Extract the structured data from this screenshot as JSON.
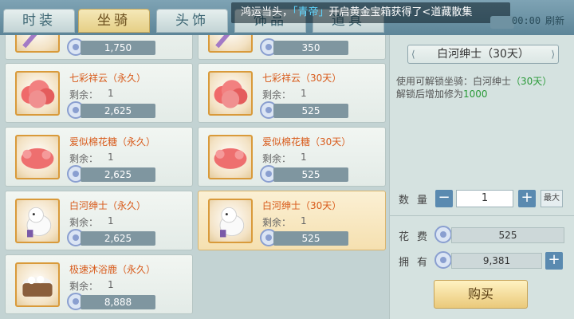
{
  "tabs": [
    "时装",
    "坐骑",
    "头饰",
    "饰品",
    "道具"
  ],
  "active_tab": 1,
  "marquee": {
    "prefix": "鸿运当头，",
    "player": "「青帝」",
    "suffix": "开启黄金宝箱获得了<道藏散集"
  },
  "timer": "00:00",
  "refresh_label": "刷新",
  "remain_label": "剩余：",
  "items": [
    {
      "name": "",
      "remain": "",
      "price": "1,750"
    },
    {
      "name": "",
      "remain": "",
      "price": "350"
    },
    {
      "name": "七彩祥云（永久）",
      "remain": "1",
      "price": "2,625",
      "icon": "cloud-icon"
    },
    {
      "name": "七彩祥云（30天）",
      "remain": "1",
      "price": "525",
      "icon": "cloud-icon"
    },
    {
      "name": "爱似棉花糖（永久）",
      "remain": "1",
      "price": "2,625",
      "icon": "cotton-candy-icon"
    },
    {
      "name": "爱似棉花糖（30天）",
      "remain": "1",
      "price": "525",
      "icon": "cotton-candy-icon"
    },
    {
      "name": "白河绅士（永久）",
      "remain": "1",
      "price": "2,625",
      "icon": "white-horse-icon"
    },
    {
      "name": "白河绅士（30天）",
      "remain": "1",
      "price": "525",
      "icon": "white-horse-icon",
      "selected": true
    },
    {
      "name": "极速沐浴鹿（永久）",
      "remain": "1",
      "price": "8,888",
      "icon": "bath-tub-icon"
    }
  ],
  "detail": {
    "title": "白河绅士（30天）",
    "desc_prefix": "使用可解锁坐骑：白河绅士",
    "desc_green": "（30天）",
    "desc2_prefix": "解锁后增加修为",
    "desc2_value": "1000",
    "qty_label": "数量",
    "qty_value": "1",
    "max_label": "最大",
    "cost_label": "花费",
    "cost_value": "525",
    "own_label": "拥有",
    "own_value": "9,381",
    "buy_label": "购买"
  },
  "colors": {
    "accent": "#d85a1a",
    "selected": "#f5e0b0",
    "green": "#2a9a38"
  }
}
